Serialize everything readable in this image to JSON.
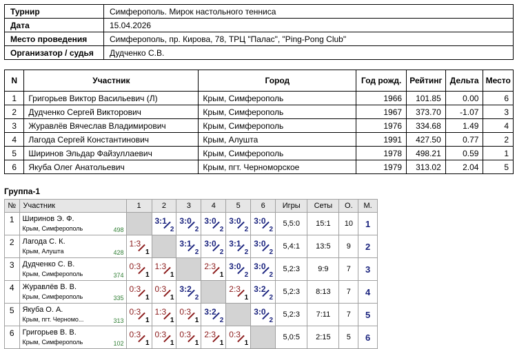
{
  "info": [
    {
      "label": "Турнир",
      "value": "Симферополь. Мирок настольного тенниса"
    },
    {
      "label": "Дата",
      "value": "15.04.2026"
    },
    {
      "label": "Место проведения",
      "value": "Симферополь, пр. Кирова, 78, ТРЦ \"Палас\", \"Ping-Pong Club\""
    },
    {
      "label": "Организатор / судья",
      "value": "Дудченко С.В."
    }
  ],
  "participants": {
    "headers": {
      "n": "N",
      "name": "Участник",
      "city": "Город",
      "year": "Год рожд.",
      "rating": "Рейтинг",
      "delta": "Дельта",
      "place": "Место"
    },
    "rows": [
      {
        "n": "1",
        "name": "Григорьев Виктор Васильевич (Л)",
        "city": "Крым, Симферополь",
        "year": "1966",
        "rating": "101.85",
        "delta": "0.00",
        "place": "6"
      },
      {
        "n": "2",
        "name": "Дудченко Сергей Викторович",
        "city": "Крым, Симферополь",
        "year": "1967",
        "rating": "373.70",
        "delta": "-1.07",
        "place": "3"
      },
      {
        "n": "3",
        "name": "Журавлёв Вячеслав Владимирович",
        "city": "Крым, Симферополь",
        "year": "1976",
        "rating": "334.68",
        "delta": "1.49",
        "place": "4"
      },
      {
        "n": "4",
        "name": "Лагода Сергей Константинович",
        "city": "Крым, Алушта",
        "year": "1991",
        "rating": "427.50",
        "delta": "0.77",
        "place": "2"
      },
      {
        "n": "5",
        "name": "Ширинов Эльдар Файзуллаевич",
        "city": "Крым, Симферополь",
        "year": "1978",
        "rating": "498.21",
        "delta": "0.59",
        "place": "1"
      },
      {
        "n": "6",
        "name": "Якуба Олег Анатольевич",
        "city": "Крым, пгт. Черноморское",
        "year": "1979",
        "rating": "313.02",
        "delta": "2.04",
        "place": "5"
      }
    ]
  },
  "group": {
    "title": "Группа-1",
    "headers": {
      "n": "№",
      "name": "Участник",
      "c1": "1",
      "c2": "2",
      "c3": "3",
      "c4": "4",
      "c5": "5",
      "c6": "6",
      "games": "Игры",
      "sets": "Сеты",
      "points": "О.",
      "place": "М."
    },
    "rows": [
      {
        "n": "1",
        "name": "Ширинов Э. Ф.",
        "city": "Крым, Симферополь",
        "rating": "498",
        "cells": [
          null,
          {
            "s": "3:1",
            "p": "2",
            "w": true
          },
          {
            "s": "3:0",
            "p": "2",
            "w": true
          },
          {
            "s": "3:0",
            "p": "2",
            "w": true
          },
          {
            "s": "3:0",
            "p": "2",
            "w": true
          },
          {
            "s": "3:0",
            "p": "2",
            "w": true
          }
        ],
        "games": "5,5:0",
        "sets": "15:1",
        "points": "10",
        "place": "1"
      },
      {
        "n": "2",
        "name": "Лагода С. К.",
        "city": "Крым, Алушта",
        "rating": "428",
        "cells": [
          {
            "s": "1:3",
            "p": "1",
            "w": false
          },
          null,
          {
            "s": "3:1",
            "p": "2",
            "w": true
          },
          {
            "s": "3:0",
            "p": "2",
            "w": true
          },
          {
            "s": "3:1",
            "p": "2",
            "w": true
          },
          {
            "s": "3:0",
            "p": "2",
            "w": true
          }
        ],
        "games": "5,4:1",
        "sets": "13:5",
        "points": "9",
        "place": "2"
      },
      {
        "n": "3",
        "name": "Дудченко С. В.",
        "city": "Крым, Симферополь",
        "rating": "374",
        "cells": [
          {
            "s": "0:3",
            "p": "1",
            "w": false
          },
          {
            "s": "1:3",
            "p": "1",
            "w": false
          },
          null,
          {
            "s": "2:3",
            "p": "1",
            "w": false
          },
          {
            "s": "3:0",
            "p": "2",
            "w": true
          },
          {
            "s": "3:0",
            "p": "2",
            "w": true
          }
        ],
        "games": "5,2:3",
        "sets": "9:9",
        "points": "7",
        "place": "3"
      },
      {
        "n": "4",
        "name": "Журавлёв В. В.",
        "city": "Крым, Симферополь",
        "rating": "335",
        "cells": [
          {
            "s": "0:3",
            "p": "1",
            "w": false
          },
          {
            "s": "0:3",
            "p": "1",
            "w": false
          },
          {
            "s": "3:2",
            "p": "2",
            "w": true
          },
          null,
          {
            "s": "2:3",
            "p": "1",
            "w": false
          },
          {
            "s": "3:2",
            "p": "2",
            "w": true
          }
        ],
        "games": "5,2:3",
        "sets": "8:13",
        "points": "7",
        "place": "4"
      },
      {
        "n": "5",
        "name": "Якуба О. А.",
        "city": "Крым, пгт. Черномо...",
        "rating": "313",
        "cells": [
          {
            "s": "0:3",
            "p": "1",
            "w": false
          },
          {
            "s": "1:3",
            "p": "1",
            "w": false
          },
          {
            "s": "0:3",
            "p": "1",
            "w": false
          },
          {
            "s": "3:2",
            "p": "2",
            "w": true
          },
          null,
          {
            "s": "3:0",
            "p": "2",
            "w": true
          }
        ],
        "games": "5,2:3",
        "sets": "7:11",
        "points": "7",
        "place": "5"
      },
      {
        "n": "6",
        "name": "Григорьев В. В.",
        "city": "Крым, Симферополь",
        "rating": "102",
        "cells": [
          {
            "s": "0:3",
            "p": "1",
            "w": false
          },
          {
            "s": "0:3",
            "p": "1",
            "w": false
          },
          {
            "s": "0:3",
            "p": "1",
            "w": false
          },
          {
            "s": "2:3",
            "p": "1",
            "w": false
          },
          {
            "s": "0:3",
            "p": "1",
            "w": false
          },
          null
        ],
        "games": "5,0:5",
        "sets": "2:15",
        "points": "5",
        "place": "6"
      }
    ]
  }
}
